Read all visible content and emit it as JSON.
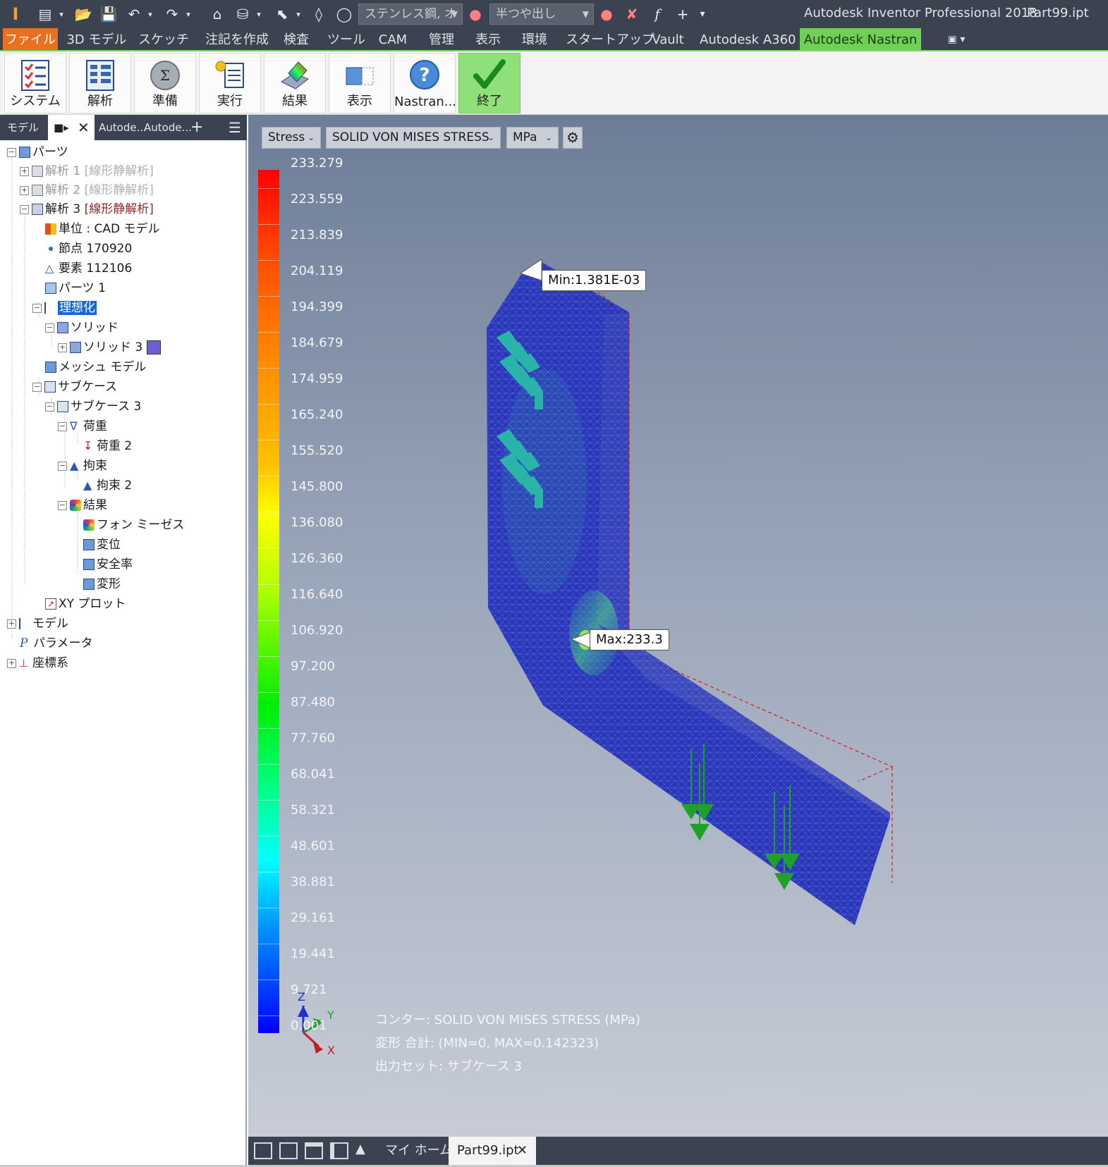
{
  "title_bar": {
    "material": "ステンレス鋼, オ",
    "appearance": "半つや出し",
    "app_name": "Autodesk Inventor Professional 2018",
    "file_name": "Part99.ipt"
  },
  "menu": {
    "items": [
      "ファイル",
      "3D モデル",
      "スケッチ",
      "注記を作成",
      "検査",
      "ツール",
      "CAM",
      "管理",
      "表示",
      "環境",
      "スタートアップ",
      "Vault",
      "Autodesk A360",
      "Autodesk Nastran"
    ],
    "active": "Autodesk Nastran"
  },
  "ribbon": {
    "buttons": [
      "システム",
      "解析",
      "準備",
      "実行",
      "結果",
      "表示",
      "Nastran...",
      "終了"
    ]
  },
  "panel": {
    "tabs": [
      "モデル",
      "Autode...",
      "Autode..."
    ]
  },
  "tree": {
    "parts": "パーツ",
    "analysis1": "解析 1",
    "analysis1_type": "[線形静解析]",
    "analysis2": "解析 2",
    "analysis2_type": "[線形静解析]",
    "analysis3": "解析 3",
    "analysis3_type": "[線形静解析]",
    "units": "単位 : CAD モデル",
    "nodes": "節点 170920",
    "elements": "要素 112106",
    "part1": "パーツ 1",
    "idealization": "理想化",
    "solid": "ソリッド",
    "solid3": "ソリッド 3",
    "mesh_model": "メッシュ モデル",
    "subcases": "サブケース",
    "subcase3": "サブケース 3",
    "loads": "荷重",
    "load2": "荷重 2",
    "constraints": "拘束",
    "constraint2": "拘束 2",
    "results": "結果",
    "von_mises": "フォン ミーゼス",
    "displacement": "変位",
    "safety_factor": "安全率",
    "deformation": "変形",
    "xy_plot": "XY プロット",
    "model": "モデル",
    "parameters": "パラメータ",
    "coord_system": "座標系"
  },
  "viewport": {
    "result_type": "Stress",
    "result_component": "SOLID VON MISES STRESS",
    "unit": "MPa",
    "legend_values": [
      "233.279",
      "223.559",
      "213.839",
      "204.119",
      "194.399",
      "184.679",
      "174.959",
      "165.240",
      "155.520",
      "145.800",
      "136.080",
      "126.360",
      "116.640",
      "106.920",
      "97.200",
      "87.480",
      "77.760",
      "68.041",
      "58.321",
      "48.601",
      "38.881",
      "29.161",
      "19.441",
      "9.721",
      "0.001"
    ],
    "min_label": "Min:1.381E-03",
    "max_label": "Max:233.3",
    "axis_z": "Z",
    "axis_y": "Y",
    "axis_x": "X",
    "contour_info": "コンター: SOLID VON MISES STRESS (MPa)",
    "deformation_info": "変形 合計: (MIN=0, MAX=0.142323)",
    "output_set_info": "出力セット: サブケース 3"
  },
  "bottom_bar": {
    "tabs": [
      "マイ ホーム",
      "Part99.ipt"
    ]
  },
  "colors": {
    "file_tab": "#e8701e",
    "active_tab": "#6fcf57",
    "selection": "#1769d1",
    "mesh_blue": "#2a36b8",
    "load_arrow": "#1fa02a",
    "constraint": "#2ab3a8"
  }
}
